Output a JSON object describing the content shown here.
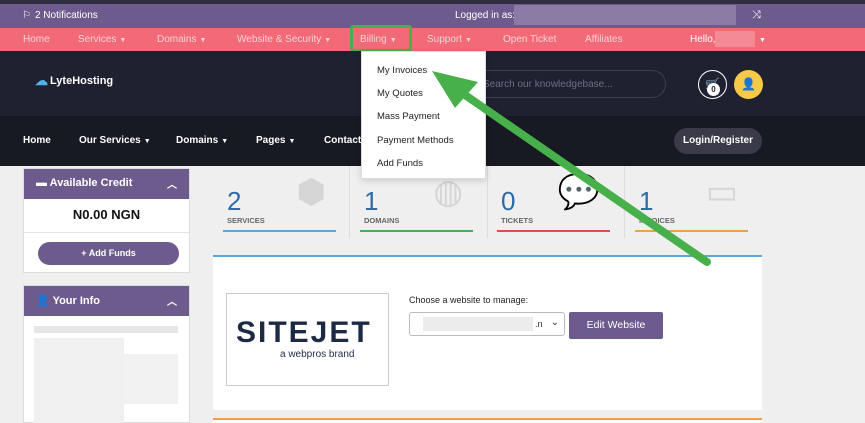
{
  "topbar": {
    "notifications": "2 Notifications",
    "logged_in_as": "Logged in as:"
  },
  "primary_nav": {
    "items": [
      "Home",
      "Services",
      "Domains",
      "Website & Security",
      "Billing",
      "Support",
      "Open Ticket",
      "Affiliates"
    ],
    "greeting": "Hello,"
  },
  "brand": {
    "logo_text": "LyteHosting"
  },
  "header": {
    "search_placeholder": "Search our knowledgebase...",
    "cart_count": "0"
  },
  "main_nav": {
    "items": [
      "Home",
      "Our Services",
      "Domains",
      "Pages",
      "Contact"
    ],
    "login_label": "Login/Register"
  },
  "billing_menu": {
    "items": [
      "My Invoices",
      "My Quotes",
      "Mass Payment",
      "Payment Methods",
      "Add Funds"
    ]
  },
  "credit_panel": {
    "title": "Available Credit",
    "amount": "N0.00 NGN",
    "add_funds": "Add Funds"
  },
  "info_panel": {
    "title": "Your Info"
  },
  "stats": [
    {
      "value": "2",
      "label": "SERVICES",
      "color": "#5aa9d6"
    },
    {
      "value": "1",
      "label": "DOMAINS",
      "color": "#48b04a"
    },
    {
      "value": "0",
      "label": "TICKETS",
      "color": "#e24b4b"
    },
    {
      "value": "1",
      "label": "INVOICES",
      "color": "#f0a04b"
    }
  ],
  "sitejet": {
    "logo_word": "SITEJET",
    "logo_sub": "a webpros brand",
    "choose_label": "Choose a website to manage:",
    "select_tail": ".n",
    "edit_button": "Edit Website"
  },
  "colors": {
    "accent_purple": "#6e5b8d",
    "nav_pink": "#f26a77",
    "highlight_green": "#48b04a",
    "header_dark": "#1f2130"
  }
}
